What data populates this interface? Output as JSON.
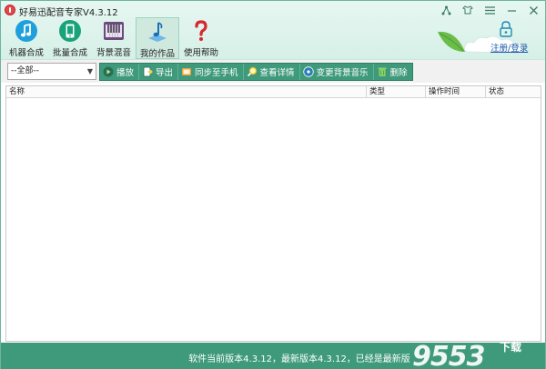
{
  "window": {
    "title": "好易迅配音专家V4.3.12",
    "controls": [
      "network-icon",
      "skin-icon",
      "menu-icon",
      "minimize-icon",
      "close-icon"
    ]
  },
  "nav": {
    "items": [
      {
        "label": "机器合成",
        "icon": "music-note-icon",
        "active": false
      },
      {
        "label": "批量合成",
        "icon": "phone-icon",
        "active": false
      },
      {
        "label": "背景混音",
        "icon": "piano-icon",
        "active": false
      },
      {
        "label": "我的作品",
        "icon": "folder-music-icon",
        "active": true
      },
      {
        "label": "使用帮助",
        "icon": "question-icon",
        "active": false
      }
    ]
  },
  "account": {
    "login_label": "注册/登录"
  },
  "toolbar": {
    "category_selected": "--全部--",
    "actions": [
      {
        "label": "播放",
        "icon": "play-icon"
      },
      {
        "label": "导出",
        "icon": "export-icon"
      },
      {
        "label": "同步至手机",
        "icon": "sync-phone-icon"
      },
      {
        "label": "查看详情",
        "icon": "magnifier-icon"
      },
      {
        "label": "变更背景音乐",
        "icon": "disc-icon"
      },
      {
        "label": "删除",
        "icon": "trash-icon"
      }
    ]
  },
  "list": {
    "columns": [
      "名称",
      "类型",
      "操作时间",
      "状态"
    ],
    "rows": []
  },
  "status": {
    "text": "软件当前版本4.3.12，最新版本4.3.12，已经是最新版"
  },
  "watermark": {
    "text": "9553",
    "sub": "下载"
  },
  "colors": {
    "accent": "#3f9a7c",
    "header_bg": "#e6f7f1",
    "link": "#1a5aa8"
  }
}
